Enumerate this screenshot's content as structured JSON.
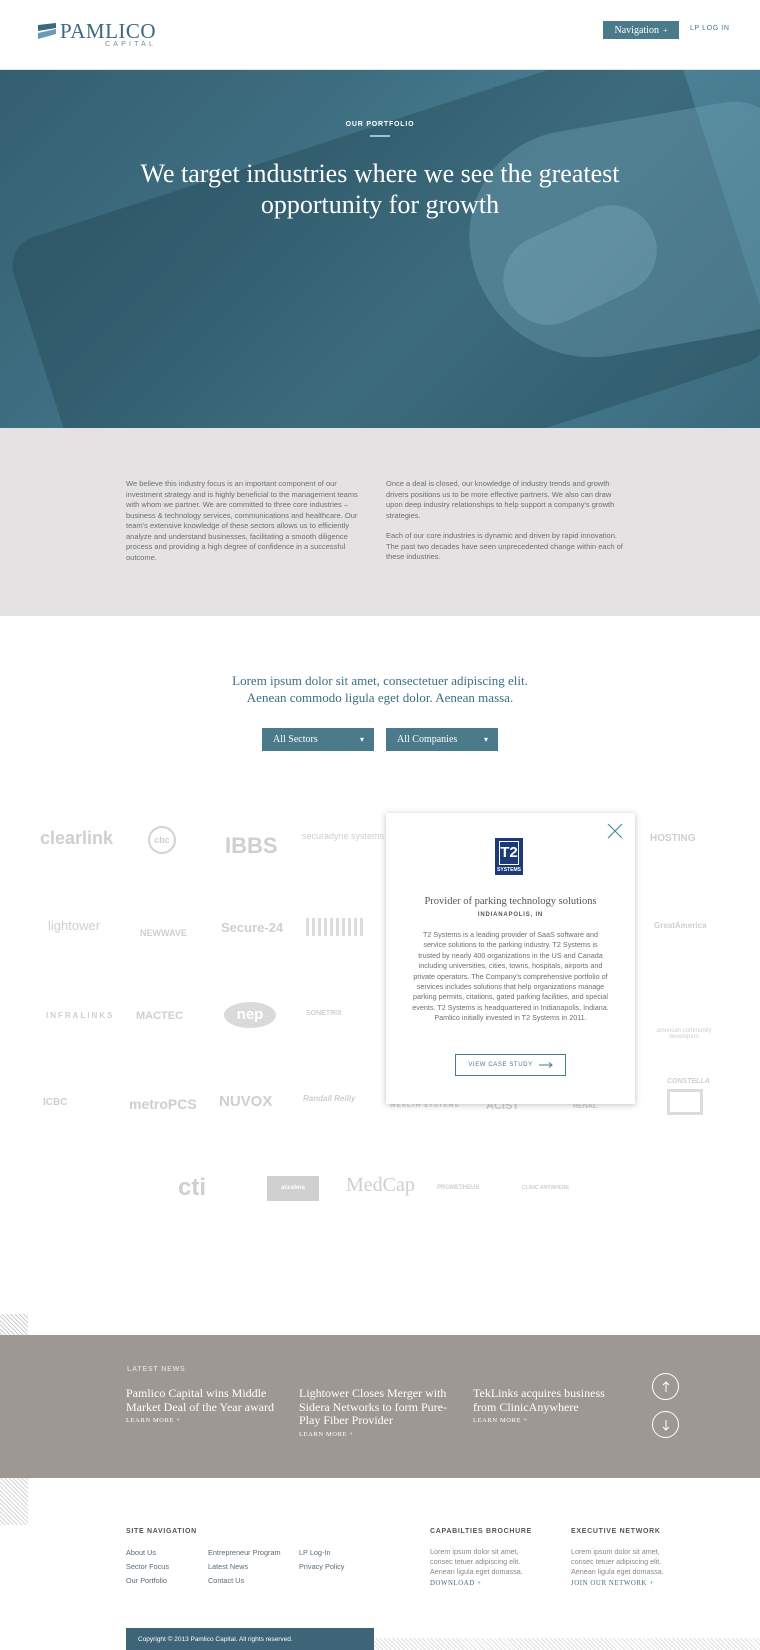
{
  "header": {
    "logo": {
      "name": "PAMLICO",
      "sub": "CAPITAL"
    },
    "nav_label": "Navigation",
    "nav_icon": "plus-icon",
    "lp_login": "LP LOG IN"
  },
  "hero": {
    "kicker": "OUR PORTFOLIO",
    "title": "We target industries where we see the greatest opportunity for growth"
  },
  "intro": {
    "left": "We believe this industry focus is an important component of our investment strategy and is highly beneficial to the management teams with whom we partner. We are committed to three core industries – business & technology services, communications and healthcare. Our team's extensive knowledge of these sectors allows us to efficiently analyze and understand businesses, facilitating a smooth diligence process and providing a high degree of confidence in a successful outcome.",
    "right_1": "Once a deal is closed, our knowledge of industry trends and growth drivers positions us to be more effective partners. We also can draw upon deep industry relationships to help support a company's growth strategies.",
    "right_2": "Each of our core industries is dynamic and driven by rapid innovation. The past two decades have seen unprecedented change within each of these industries."
  },
  "portfolio": {
    "lead_1": "Lorem ipsum dolor sit amet, consectetuer adipiscing elit.",
    "lead_2": "Aenean commodo ligula eget dolor. Aenean massa.",
    "filter_sectors": "All Sectors",
    "filter_companies": "All Companies",
    "logos": {
      "clearlink": "clearlink",
      "cbc": "cbc",
      "ibbs": "IBBS",
      "securadyne": "securadyne systems",
      "hosting": "HOSTING",
      "lightower": "lightower",
      "newwave": "NEWWAVE",
      "secure24": "Secure-24",
      "greatamerica": "GreatAmerica",
      "infralinks": "INFRALINKS",
      "mactec": "MACTEC",
      "nep": "nep",
      "sonetrix": "SONETRIX",
      "acc": "american community developers",
      "icbc": "ICBC",
      "metropcs": "metroPCS",
      "nuvox": "NUVOX",
      "randall": "Randall Reilly",
      "wealth": "WEALTH SYSTEMS",
      "acist": "ACIST",
      "renal": "RENAL",
      "constella": "CONSTELLA",
      "cti": "cti",
      "accelera": "accelera",
      "medcap": "MedCap",
      "prometheus": "PROMETHEUS",
      "clinic": "CLINIC ANYWHERE"
    }
  },
  "popup": {
    "logo_top": "T2",
    "logo_bottom": "SYSTEMS",
    "title": "Provider of parking technology solutions",
    "location": "INDIANAPOLIS, IN",
    "description": "T2 Systems is a leading provider of SaaS software and service solutions to the parking industry. T2 Systems is trusted by nearly 400 organizations in the US and Canada including universities, cities, towns, hospitals, airports and private operators. The Company's comprehensive portfolio of services includes solutions that help organizations manage parking permits, citations, gated parking facilities, and special events. T2 Systems is headquartered in Indianapolis, Indiana. Pamlico initially invested in T2 Systems in 2011.",
    "button": "VIEW CASE STUDY"
  },
  "news": {
    "kicker": "LATEST NEWS",
    "items": [
      {
        "title": "Pamlico Capital wins Middle Market Deal of the Year award",
        "more": "LEARN MORE +"
      },
      {
        "title": "Lightower Closes Merger with Sidera Networks to form Pure-Play Fiber Provider",
        "more": "LEARN MORE +"
      },
      {
        "title": "TekLinks acquires business from ClinicAnywhere",
        "more": "LEARN MORE +"
      }
    ]
  },
  "footer": {
    "site_nav_heading": "SITE NAVIGATION",
    "col1": [
      "About Us",
      "Sector Focus",
      "Our Portfolio"
    ],
    "col2": [
      "Entrepreneur Program",
      "Latest News",
      "Contact Us"
    ],
    "col3": [
      "LP Log-In",
      "Privacy Policy"
    ],
    "brochure_heading": "CAPABILTIES BROCHURE",
    "brochure_text": "Lorem ipsum dolor sit amet, consec tetuer adipiscing elit. Aenean ligula eget domassa.",
    "brochure_action": "DOWNLOAD +",
    "exec_heading": "EXECUTIVE NETWORK",
    "exec_text": "Lorem ipsum dolor sit amet, consec tetuer adipiscing elit. Aenean ligula eget domassa.",
    "exec_action": "JOIN OUR NETWORK +",
    "copyright": "Copyright © 2013 Pamlico Capital. All rights reserved."
  }
}
